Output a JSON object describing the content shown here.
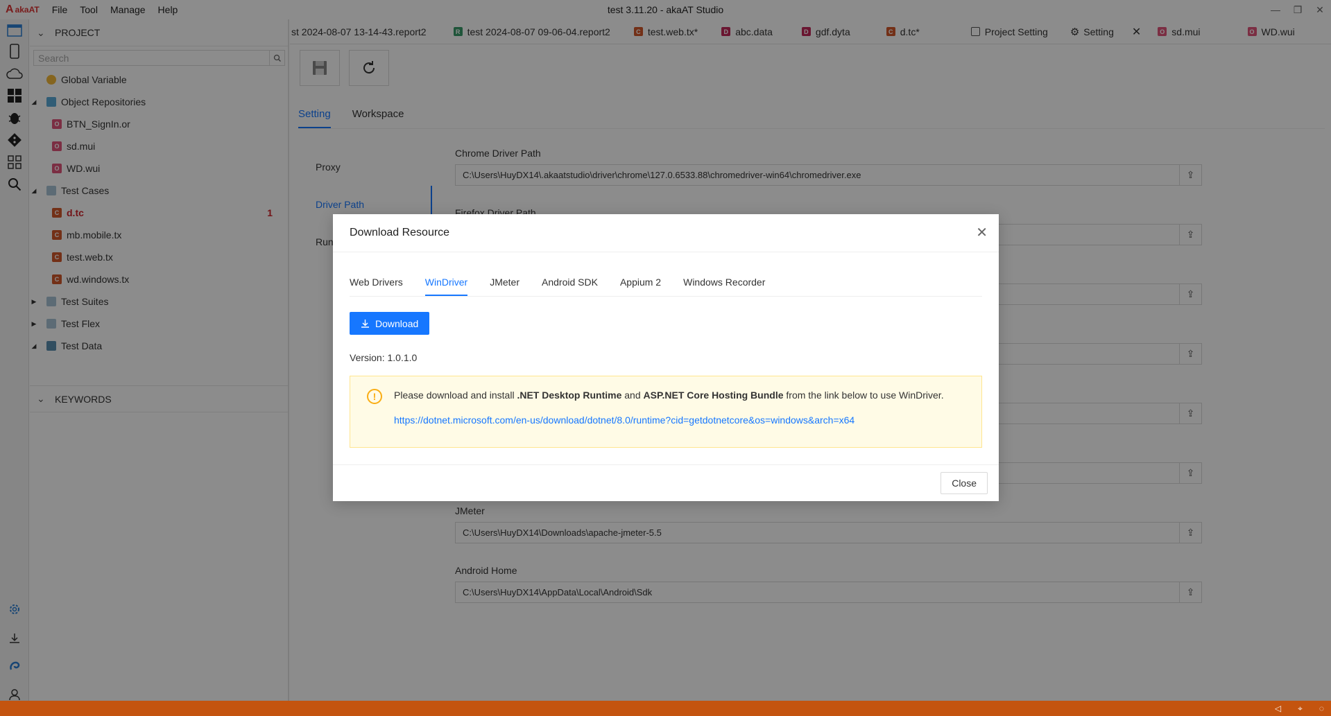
{
  "app": {
    "logo_text": "akaAT",
    "window_title": "test 3.11.20 - akaAT Studio",
    "menu": [
      "File",
      "Tool",
      "Manage",
      "Help"
    ]
  },
  "project_panel": {
    "header": "PROJECT",
    "search_placeholder": "Search",
    "tree": [
      {
        "label": "Global Variable"
      },
      {
        "label": "Object Repositories"
      },
      {
        "label": "BTN_SignIn.or"
      },
      {
        "label": "sd.mui"
      },
      {
        "label": "WD.wui"
      },
      {
        "label": "Test Cases"
      },
      {
        "label": "d.tc",
        "badge": "1"
      },
      {
        "label": "mb.mobile.tx"
      },
      {
        "label": "test.web.tx"
      },
      {
        "label": "wd.windows.tx"
      },
      {
        "label": "Test Suites"
      },
      {
        "label": "Test Flex"
      },
      {
        "label": "Test Data"
      }
    ],
    "keywords_header": "KEYWORDS"
  },
  "tabs": [
    {
      "label": "st 2024-08-07 13-14-43.report2",
      "icon": ""
    },
    {
      "label": "test 2024-08-07 09-06-04.report2",
      "icon": "R"
    },
    {
      "label": "test.web.tx*",
      "icon": "C"
    },
    {
      "label": "abc.data",
      "icon": "D"
    },
    {
      "label": "gdf.dyta",
      "icon": "D"
    },
    {
      "label": "d.tc*",
      "icon": "C"
    },
    {
      "label": "Project Setting",
      "icon": "project-setting-icon"
    },
    {
      "label": "Setting",
      "icon": "gear-icon"
    },
    {
      "label": "sd.mui",
      "icon": "O"
    },
    {
      "label": "WD.wui",
      "icon": "O"
    }
  ],
  "settings": {
    "tabs": [
      "Setting",
      "Workspace"
    ],
    "left_menu": [
      "Proxy",
      "Driver Path",
      "Run"
    ],
    "fields": {
      "chrome_label": "Chrome Driver Path",
      "chrome_value": "C:\\Users\\HuyDX14\\.akaatstudio\\driver\\chrome\\127.0.6533.88\\chromedriver-win64\\chromedriver.exe",
      "firefox_label": "Firefox Driver Path",
      "jmeter_label": "JMeter",
      "jmeter_value": "C:\\Users\\HuyDX14\\Downloads\\apache-jmeter-5.5",
      "android_label": "Android Home",
      "android_value": "C:\\Users\\HuyDX14\\AppData\\Local\\Android\\Sdk"
    }
  },
  "modal": {
    "title": "Download Resource",
    "tabs": [
      "Web Drivers",
      "WinDriver",
      "JMeter",
      "Android SDK",
      "Appium 2",
      "Windows Recorder"
    ],
    "active_tab": "WinDriver",
    "download_label": "Download",
    "version": "Version: 1.0.1.0",
    "alert": {
      "pre": "Please download and install ",
      "b1": ".NET Desktop Runtime",
      "mid": " and ",
      "b2": "ASP.NET Core Hosting Bundle",
      "post": " from the link below to use WinDriver.",
      "link": "https://dotnet.microsoft.com/en-us/download/dotnet/8.0/runtime?cid=getdotnetcore&os=windows&arch=x64"
    },
    "close_label": "Close"
  },
  "colors": {
    "accent": "#1677ff",
    "statusbar": "#c4540f",
    "error": "#d0232a",
    "alert_bg": "#fffbe6"
  }
}
